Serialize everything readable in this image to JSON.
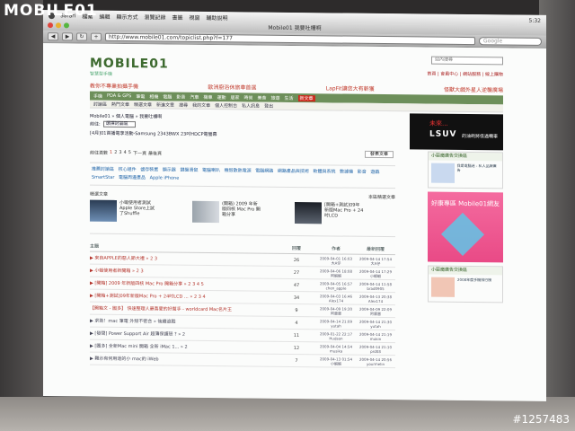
{
  "watermark": {
    "logo": "MOBILE01",
    "photo_id": "#1257483"
  },
  "os_menubar": {
    "items": [
      "Safari",
      "檔案",
      "編輯",
      "顯示方式",
      "瀏覽記錄",
      "書籤",
      "視窗",
      "輔助說明"
    ],
    "right": [
      "5:32"
    ]
  },
  "browser": {
    "window_title": "Mobile01 我要吐槽啊",
    "url": "http://www.mobile01.com/topiclist.php?f=177",
    "search_placeholder": "Google",
    "back_icon": "back-arrow-icon",
    "forward_icon": "forward-arrow-icon",
    "reload_icon": "reload-icon",
    "colors": {
      "close": "#e0443b",
      "minimize": "#e8b130",
      "zoom": "#56b640"
    }
  },
  "site": {
    "logo": "MOBILE01",
    "tagline": "智慧型手機",
    "search_placeholder": "站內搜尋",
    "top_links": "首頁 | 會員中心 | 網站服務 | 線上購物",
    "promos": [
      "教你不專業拍攝手機",
      "歐洲廚浴休旅車首選",
      "LapFit讓您大有斬獲",
      "怪獸大戲外星人逆襲廣場"
    ],
    "nav": [
      "手機",
      "PDA & GPS",
      "筆電",
      "相機",
      "電腦",
      "影音",
      "汽車",
      "機車",
      "運動",
      "居家",
      "時尚",
      "美食",
      "旅遊",
      "生活"
    ],
    "nav_hot": "新文章",
    "subnav": [
      "討論區",
      "熱門文章",
      "精選文章",
      "新進文章",
      "搜尋",
      "我的文章",
      "個人控制台",
      "私人訊息",
      "登出"
    ]
  },
  "forum": {
    "breadcrumb": "Mobile01 » 個人電腦 » 我要吐槽啊",
    "goto_label": "前往:",
    "goto_select": "選擇討論區",
    "hot_topic": "[4月]01首播電享活動-Samsung 2343BWX 23吋HDCP電螢幕",
    "ad_top": "未來...",
    "ad_brand": "LSUV",
    "ad_text": "的油耗將低過轎車",
    "pager_label": "前往頁數",
    "pager_pages": [
      "1",
      "2",
      "3",
      "4",
      "5",
      "下一頁",
      "最後頁"
    ],
    "post_button": "發表文章",
    "forum_links": [
      "推薦討論區",
      "核心組件",
      "儲存裝置",
      "顯示器",
      "鍵盤滑鼠",
      "電腦喇叭",
      "機殼散熱電源",
      "電腦網路",
      "網路產品與技術",
      "軟體與系統",
      "數據機",
      "影音",
      "遊戲",
      "SmartStar",
      "電腦周邊產品",
      "Apple iPhone"
    ],
    "feature_title": "精選文章",
    "feature_more": "本區精選文章",
    "features": [
      {
        "text": "小蝦使用者測試Apple Store上試了Shuffle",
        "tag": ""
      },
      {
        "text": "(開箱) 2009 年新版四核 Mac Pro 開箱分享",
        "tag": "開箱"
      },
      {
        "text": "[開箱+測試]09年新版Mac Pro + 24吋LCD",
        "tag": "開箱"
      }
    ],
    "columns": [
      "主題",
      "回覆",
      "作者",
      "最新回覆"
    ],
    "threads": [
      {
        "title": "▶ 來自APPLE的惡人節大禮 » 2 3",
        "replies": "26",
        "date1": "2009-04-01 16:03",
        "author": "大A仔",
        "date2": "2009-04-14 17:54",
        "last": "大A仔",
        "hot": true
      },
      {
        "title": "▶ 小蝦使用者新開箱 » 2 3",
        "replies": "27",
        "date1": "2009-04-06 18:08",
        "author": "阿蝦蝦",
        "date2": "2009-04-14 17:29",
        "last": "小蝦蝦",
        "hot": true
      },
      {
        "title": "▶ [開箱] 2009 年新版四核 Mac Pro 開箱分享 » 2 3 4 5",
        "replies": "47",
        "date1": "2009-04-05 16:57",
        "author": "chen_apple",
        "date2": "2009-04-14 11:58",
        "last": "brad0905",
        "hot": true
      },
      {
        "title": "▶ [開箱+測試]09年新版Mac Pro + 24吋LCD ... » 2 3 4",
        "replies": "34",
        "date1": "2009-04-03 16:46",
        "author": "Alex174",
        "date2": "2009-04-13 20:38",
        "last": "Alex174",
        "hot": true
      },
      {
        "title": "【開箱文 - 國多】 快速整理人最喜愛的好幫手 - worldcard Mac名片王",
        "replies": "9",
        "date1": "2009-04-09 19:30",
        "author": "阿雷雷",
        "date2": "2009-04-09 22:09",
        "last": "阿雷雷",
        "hot": true
      },
      {
        "title": "▶ 求助！mac 筆電 外殼不密合 » 後續追蹤",
        "replies": "4",
        "date1": "2009-04-14 21:09",
        "author": "yutah",
        "date2": "2009-04-14 21:30",
        "last": "yutah",
        "hot": false
      },
      {
        "title": "▶ [發問] Power Support Air 超薄保護殼 ? » 2",
        "replies": "11",
        "date1": "2009-01-22 22:17",
        "author": "Hudson",
        "date2": "2009-04-14 21:19",
        "last": "mukin",
        "hot": false
      },
      {
        "title": "▶ [圖多] 全新Mac mini 開箱 全新 iMac 1... » 2",
        "replies": "12",
        "date1": "2009-04-04 14:54",
        "author": "musika",
        "date2": "2009-04-14 21:10",
        "last": "prd08",
        "hot": false
      },
      {
        "title": "▶ 難示有何用途的小 mac的 iWeb",
        "replies": "7",
        "date1": "2009-04-13 01:54",
        "author": "小蝦蝦",
        "date2": "2009-04-14 20:56",
        "last": "yourmelin",
        "hot": false
      }
    ],
    "side_header": "小惡魔廣告交換區",
    "side_ad_title": "好康專區 Mobile01網友",
    "side_ad2": "小惡魔廣告交換區",
    "side_mini1": "我是電腦迷 - 私人品牌廣告",
    "side_mini2": "2008年度手機排行榜"
  }
}
